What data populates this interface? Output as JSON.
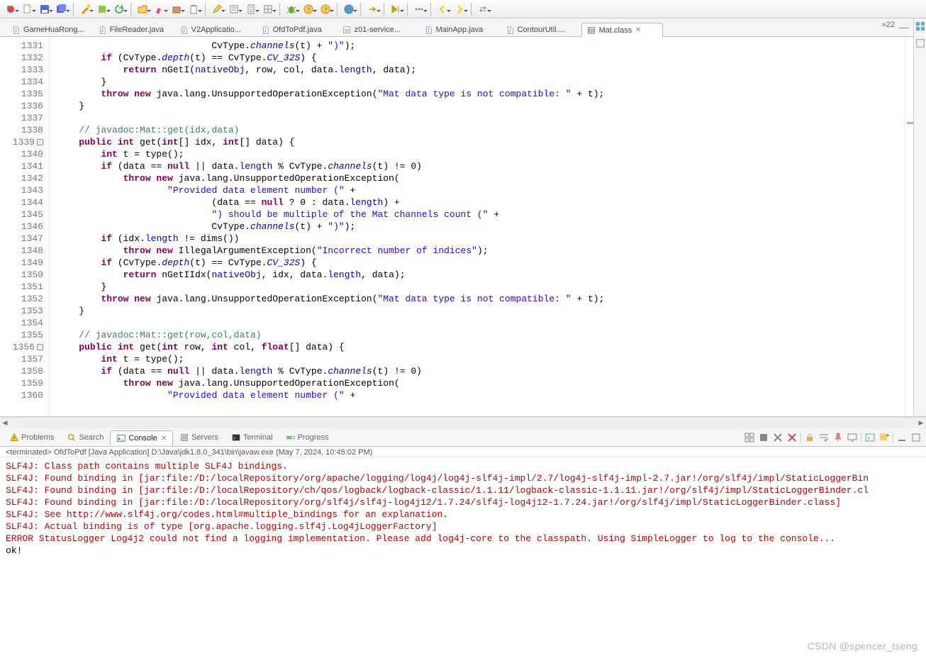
{
  "toolbar_icons": [
    "debug",
    "new",
    "save",
    "saveall",
    "|",
    "wiz",
    "ext",
    "refresh",
    "|",
    "open",
    "brush",
    "pkg",
    "clip",
    "|",
    "pencil",
    "task",
    "doc",
    "grid",
    "|",
    "bug",
    "help",
    "help2",
    "|",
    "globe",
    "|",
    "arrow",
    "|",
    "skip",
    "|",
    "dots",
    "|",
    "back",
    "fwd",
    "|",
    "swap"
  ],
  "tabs": [
    {
      "icon": "java",
      "label": "GameHuaRong...",
      "active": false
    },
    {
      "icon": "java",
      "label": "FileReader.java",
      "active": false
    },
    {
      "icon": "java",
      "label": "V2Applicatio...",
      "active": false
    },
    {
      "icon": "java",
      "label": "OfdToPdf.java",
      "active": false
    },
    {
      "icon": "misc",
      "label": "z01-service...",
      "active": false
    },
    {
      "icon": "java",
      "label": "MainApp.java",
      "active": false
    },
    {
      "icon": "java",
      "label": "ContourUtil....",
      "active": false
    },
    {
      "icon": "class",
      "label": "Mat.class",
      "active": true
    }
  ],
  "tabs_overflow": "»22",
  "line_start": 1331,
  "code_lines": [
    {
      "n": 1331,
      "html": "                            CvType.<span class='stat'>channels</span>(t) + <span class='str'>\")\"</span>);"
    },
    {
      "n": 1332,
      "html": "        <span class='kw'>if</span> (CvType.<span class='stat'>depth</span>(t) == CvType.<span class='stat'>CV_32S</span>) {"
    },
    {
      "n": 1333,
      "html": "            <span class='kw'>return</span> <span class='mem'>nGetI</span>(<span class='fld'>nativeObj</span>, row, col, data.<span class='fld'>length</span>, data);"
    },
    {
      "n": 1334,
      "html": "        }"
    },
    {
      "n": 1335,
      "html": "        <span class='kw'>throw new</span> java.lang.UnsupportedOperationException(<span class='str'>\"Mat data type is not compatible: \"</span> + t);"
    },
    {
      "n": 1336,
      "html": "    }"
    },
    {
      "n": 1337,
      "html": ""
    },
    {
      "n": 1338,
      "html": "    <span class='cmt'>// javadoc:Mat::get(idx,data)</span>"
    },
    {
      "n": 1339,
      "mark": "-",
      "html": "    <span class='kw'>public int</span> get(<span class='kw'>int</span>[] idx, <span class='kw'>int</span>[] data) {"
    },
    {
      "n": 1340,
      "html": "        <span class='kw'>int</span> t = type();"
    },
    {
      "n": 1341,
      "html": "        <span class='kw'>if</span> (data == <span class='kw'>null</span> || data.<span class='fld'>length</span> % CvType.<span class='stat'>channels</span>(t) != 0)"
    },
    {
      "n": 1342,
      "html": "            <span class='kw'>throw new</span> java.lang.UnsupportedOperationException("
    },
    {
      "n": 1343,
      "html": "                    <span class='str'>\"Provided data element number (\"</span> +"
    },
    {
      "n": 1344,
      "html": "                            (data == <span class='kw'>null</span> ? 0 : data.<span class='fld'>length</span>) +"
    },
    {
      "n": 1345,
      "html": "                            <span class='str'>\") should be multiple of the Mat channels count (\"</span> +"
    },
    {
      "n": 1346,
      "html": "                            CvType.<span class='stat'>channels</span>(t) + <span class='str'>\")\"</span>);"
    },
    {
      "n": 1347,
      "html": "        <span class='kw'>if</span> (idx.<span class='fld'>length</span> != dims())"
    },
    {
      "n": 1348,
      "html": "            <span class='kw'>throw new</span> IllegalArgumentException(<span class='str'>\"Incorrect number of indices\"</span>);"
    },
    {
      "n": 1349,
      "html": "        <span class='kw'>if</span> (CvType.<span class='stat'>depth</span>(t) == CvType.<span class='stat'>CV_32S</span>) {"
    },
    {
      "n": 1350,
      "html": "            <span class='kw'>return</span> <span class='mem'>nGetIIdx</span>(<span class='fld'>nativeObj</span>, idx, data.<span class='fld'>length</span>, data);"
    },
    {
      "n": 1351,
      "html": "        }"
    },
    {
      "n": 1352,
      "html": "        <span class='kw'>throw new</span> java.lang.UnsupportedOperationException(<span class='str'>\"Mat data type is not compatible: \"</span> + t);"
    },
    {
      "n": 1353,
      "html": "    }"
    },
    {
      "n": 1354,
      "html": ""
    },
    {
      "n": 1355,
      "html": "    <span class='cmt'>// javadoc:Mat::get(row,col,data)</span>"
    },
    {
      "n": 1356,
      "mark": "-",
      "html": "    <span class='kw'>public int</span> get(<span class='kw'>int</span> row, <span class='kw'>int</span> col, <span class='kw'>float</span>[] data) {"
    },
    {
      "n": 1357,
      "html": "        <span class='kw'>int</span> t = type();"
    },
    {
      "n": 1358,
      "html": "        <span class='kw'>if</span> (data == <span class='kw'>null</span> || data.<span class='fld'>length</span> % CvType.<span class='stat'>channels</span>(t) != 0)"
    },
    {
      "n": 1359,
      "html": "            <span class='kw'>throw new</span> java.lang.UnsupportedOperationException("
    },
    {
      "n": 1360,
      "html": "                    <span class='str'>\"Provided data element number (\"</span> +"
    }
  ],
  "bottom_tabs": [
    {
      "icon": "warn",
      "label": "Problems",
      "active": false
    },
    {
      "icon": "search",
      "label": "Search",
      "active": false
    },
    {
      "icon": "console",
      "label": "Console",
      "active": true,
      "close": true
    },
    {
      "icon": "server",
      "label": "Servers",
      "active": false
    },
    {
      "icon": "term",
      "label": "Terminal",
      "active": false
    },
    {
      "icon": "prog",
      "label": "Progress",
      "active": false
    }
  ],
  "terminated": "<terminated> OfdToPdf [Java Application] D:\\Java\\jdk1.8.0_341\\bin\\javaw.exe (May 7, 2024, 10:45:02 PM)",
  "console": [
    {
      "cls": "err",
      "text": "SLF4J: Class path contains multiple SLF4J bindings."
    },
    {
      "cls": "err",
      "text": "SLF4J: Found binding in [jar:file:/D:/localRepository/org/apache/logging/log4j/log4j-slf4j-impl/2.7/log4j-slf4j-impl-2.7.jar!/org/slf4j/impl/StaticLoggerBin"
    },
    {
      "cls": "err",
      "text": "SLF4J: Found binding in [jar:file:/D:/localRepository/ch/qos/logback/logback-classic/1.1.11/logback-classic-1.1.11.jar!/org/slf4j/impl/StaticLoggerBinder.cl"
    },
    {
      "cls": "err",
      "text": "SLF4J: Found binding in [jar:file:/D:/localRepository/org/slf4j/slf4j-log4j12/1.7.24/slf4j-log4j12-1.7.24.jar!/org/slf4j/impl/StaticLoggerBinder.class]"
    },
    {
      "cls": "err",
      "text": "SLF4J: See http://www.slf4j.org/codes.html#multiple_bindings for an explanation."
    },
    {
      "cls": "err",
      "text": "SLF4J: Actual binding is of type [org.apache.logging.slf4j.Log4jLoggerFactory]"
    },
    {
      "cls": "err",
      "text": "ERROR StatusLogger Log4j2 could not find a logging implementation. Please add log4j-core to the classpath. Using SimpleLogger to log to the console..."
    },
    {
      "cls": "ok",
      "text": "ok!"
    }
  ],
  "watermark": "CSDN @spencer_tseng"
}
